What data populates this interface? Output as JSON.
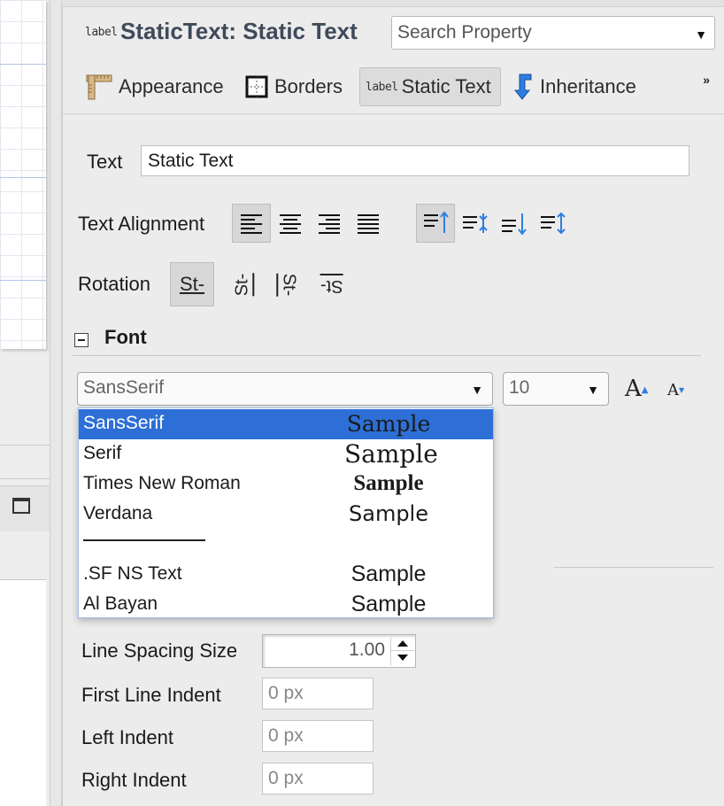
{
  "header": {
    "badge": "label",
    "title": "StaticText: Static Text",
    "search_placeholder": "Search Property"
  },
  "tabs": [
    {
      "label": "Appearance",
      "icon": "ruler-icon"
    },
    {
      "label": "Borders",
      "icon": "borders-icon"
    },
    {
      "label": "Static Text",
      "icon": "label-badge-icon",
      "badge": "label",
      "selected": true
    },
    {
      "label": "Inheritance",
      "icon": "inheritance-arrow-icon"
    }
  ],
  "tabs_overflow": "»",
  "text_row": {
    "label": "Text",
    "value": "Static Text"
  },
  "alignment": {
    "label": "Text Alignment"
  },
  "rotation": {
    "label": "Rotation",
    "options": [
      "St-",
      "St-",
      "St-",
      "St-"
    ]
  },
  "font_section": {
    "title": "Font",
    "family_value": "SansSerif",
    "size_value": "10",
    "increase_label": "A",
    "decrease_label": "A"
  },
  "font_dropdown": {
    "items": [
      {
        "name": "SansSerif",
        "sample": "Sample",
        "selected": true
      },
      {
        "name": "Serif",
        "sample": "Sample"
      },
      {
        "name": "Times New Roman",
        "sample": "Sample"
      },
      {
        "name": "Verdana",
        "sample": "Sample"
      },
      {
        "name": ".SF NS Text",
        "sample": "Sample"
      },
      {
        "name": "Al Bayan",
        "sample": "Sample"
      }
    ]
  },
  "paragraph": {
    "line_spacing_label": "Line Spacing Size",
    "line_spacing_value": "1.00",
    "first_indent_label": "First Line Indent",
    "first_indent_value": "0 px",
    "left_indent_label": "Left Indent",
    "left_indent_value": "0 px",
    "right_indent_label": "Right Indent",
    "right_indent_value": "0 px"
  },
  "colors": {
    "selection": "#2d6fd6",
    "title": "#3f4a5a",
    "accent_blue": "#2f7de1"
  }
}
